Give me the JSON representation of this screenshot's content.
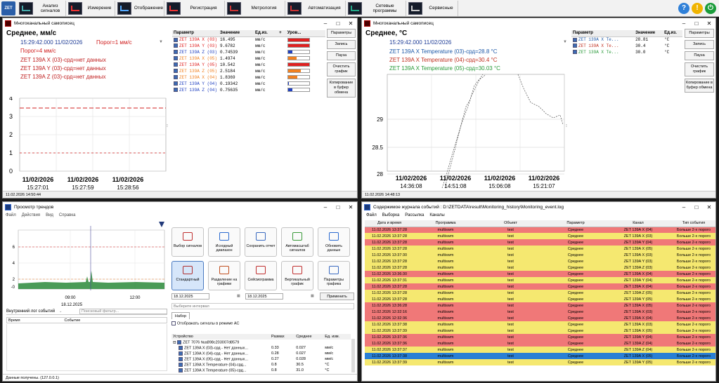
{
  "topbar": {
    "tabs": [
      {
        "label": "Анализ сигналов",
        "icon": "signal-analysis-icon"
      },
      {
        "label": "Измерение",
        "icon": "measurement-icon"
      },
      {
        "label": "Отображение",
        "icon": "display-icon"
      },
      {
        "label": "Регистрация",
        "icon": "registration-icon"
      },
      {
        "label": "Метрология",
        "icon": "metrology-icon"
      },
      {
        "label": "Автоматизация",
        "icon": "automation-icon"
      },
      {
        "label": "Сетевые программы",
        "icon": "network-icon"
      },
      {
        "label": "Сервисные",
        "icon": "service-icon"
      }
    ],
    "help": "?",
    "alert": "!",
    "power": "⏻",
    "colors": {
      "help": "#2f80d8",
      "alert": "#f0b400",
      "power": "#1a9c3a"
    }
  },
  "w1": {
    "title": "Многоканальный самописец",
    "heading": "Среднее, мм/с",
    "time": "15:29:42.000 11/02/2026",
    "threshold1": "Порог=1 мм/с",
    "threshold4": "Порог=4 мм/с",
    "lines": [
      "ZET 139A X (03)-срд=нет данных",
      "ZET 139A Y (03)-срд=нет данных",
      "ZET 139A Z (03)-срд=нет данных"
    ],
    "yticks": [
      "4",
      "3",
      "2",
      "1",
      "0"
    ],
    "xdates": [
      "11/02/2026",
      "11/02/2026",
      "11/02/2026"
    ],
    "xtimes": [
      "15:27:01",
      "15:27:59",
      "15:28:56"
    ],
    "table": {
      "cols": [
        "Параметр",
        "Значение",
        "Ед.из.",
        "+",
        "Уров..."
      ],
      "rows": [
        {
          "name": "ZET 139A X (03)",
          "value": "16.495",
          "unit": "мм/с",
          "level": 1.0,
          "color": "#e02020"
        },
        {
          "name": "ZET 139A Y (03)",
          "value": "9.6782",
          "unit": "мм/с",
          "level": 1.0,
          "color": "#e02020"
        },
        {
          "name": "ZET 139A Z (03)",
          "value": "0.74539",
          "unit": "мм/с",
          "level": 0.2,
          "color": "#2040c0"
        },
        {
          "name": "ZET 139A X (05)",
          "value": "1.4974",
          "unit": "мм/с",
          "level": 0.4,
          "color": "#f08020"
        },
        {
          "name": "ZET 139A Y (05)",
          "value": "10.542",
          "unit": "мм/с",
          "level": 1.0,
          "color": "#e02020"
        },
        {
          "name": "ZET 139A Z (05)",
          "value": "2.5184",
          "unit": "мм/с",
          "level": 0.6,
          "color": "#f08020"
        },
        {
          "name": "ZET 139A X (04)",
          "value": "1.8369",
          "unit": "мм/с",
          "level": 0.45,
          "color": "#f08020"
        },
        {
          "name": "ZET 139A Y (04)",
          "value": "0.19342",
          "unit": "мм/с",
          "level": 0.05,
          "color": "#2040c0"
        },
        {
          "name": "ZET 139A Z (04)",
          "value": "0.75635",
          "unit": "мм/с",
          "level": 0.2,
          "color": "#2040c0"
        }
      ]
    },
    "buttons": [
      "Параметры",
      "Запись",
      "Пауза",
      "Очистить график",
      "Копирование в буфер обмена"
    ],
    "status": "11.02.2026 14:50:44"
  },
  "w2": {
    "title": "Многоканальный самописец",
    "heading": "Среднее, °С",
    "time": "15:29:42.000 11/02/2026",
    "lines": [
      {
        "text": "ZET 139A X Temperature (03)-срд=28.8 °С",
        "color": "#1e5aa8"
      },
      {
        "text": "ZET 139A X Temperature (04)-срд=30.4 °С",
        "color": "#c03020"
      },
      {
        "text": "ZET 139A X Temperature (05)-срд=30.03 °С",
        "color": "#2a9a3a"
      }
    ],
    "yticks": [
      "29",
      "28.5",
      "28"
    ],
    "xdates": [
      "11/02/2026",
      "11/02/2026",
      "11/02/2026",
      "11/02/2026"
    ],
    "xtimes": [
      "14:36:08",
      "14:51:08",
      "15:06:08",
      "15:21:07"
    ],
    "table": {
      "cols": [
        "Параметр",
        "Значение",
        "Ед.из."
      ],
      "rows": [
        {
          "name": "ZET 139A X Te...",
          "value": "28.81",
          "unit": "°С",
          "color": "#1e5aa8"
        },
        {
          "name": "ZET 139A X Te...",
          "value": "30.4",
          "unit": "°С",
          "color": "#c03020"
        },
        {
          "name": "ZET 139A X Te...",
          "value": "30.0",
          "unit": "°С",
          "color": "#2a9a3a"
        }
      ]
    },
    "buttons": [
      "Параметры",
      "Запись",
      "Пауза",
      "Очистить график",
      "Копирование в буфер обмена"
    ],
    "status": "11.02.2026 14:48:13"
  },
  "w3": {
    "title": "Просмотр трендов",
    "menu": [
      "Файл",
      "Действия",
      "Вид",
      "Справка"
    ],
    "yticks": [
      "6",
      "4",
      "2",
      "-0"
    ],
    "xticks": [
      "09:00",
      "12:00"
    ],
    "xdate": "18.12.2025",
    "logtitle": "Внутренний лог событий",
    "filter": "Поисковый фильтр...",
    "logcols": [
      "Время",
      "Событие"
    ],
    "tools": [
      {
        "label": "Выбор сигналов",
        "icon": "select-signals-icon"
      },
      {
        "label": "Исходный диапазон",
        "icon": "reset-range-icon"
      },
      {
        "label": "Сохранить отчет",
        "icon": "save-report-icon"
      },
      {
        "label": "Автомасштаб сигналов",
        "icon": "autoscale-icon"
      },
      {
        "label": "Обновить данные",
        "icon": "refresh-icon"
      },
      {
        "label": "Стандартный",
        "icon": "standard-view-icon"
      },
      {
        "label": "Разделение на графики",
        "icon": "split-graphs-icon"
      },
      {
        "label": "Сейсмограмма",
        "icon": "seismogram-icon"
      },
      {
        "label": "Вертикальный график",
        "icon": "vertical-graph-icon"
      },
      {
        "label": "Параметры графика",
        "icon": "graph-params-icon"
      }
    ],
    "date_from": "18.12.2025",
    "date_to": "18.12.2025",
    "apply": "Применить",
    "interval": "Выберите интервал",
    "set_tab": "Набор",
    "ac_label": "Отображать сигналы в режиме AC",
    "devcols": [
      "Устройство",
      "Размах",
      "Среднее",
      "Ед. изм."
    ],
    "devices": [
      {
        "name": "ZET 7076 №a898c203007d8579",
        "span": "",
        "avg": "",
        "unit": "",
        "root": true
      },
      {
        "name": "ZET 139A X (03)-срд - Нет данных...",
        "span": "0.33",
        "avg": "0.027",
        "unit": "мм/с"
      },
      {
        "name": "ZET 139A X (04)-срд - Нет данных...",
        "span": "0.28",
        "avg": "0.027",
        "unit": "мм/с"
      },
      {
        "name": "ZET 139A X (05)-срд - Нет данных...",
        "span": "0.27",
        "avg": "0.028",
        "unit": "мм/с"
      },
      {
        "name": "ZET 139A X Temperature (04)-срд...",
        "span": "0.8",
        "avg": "30.5",
        "unit": "°С"
      },
      {
        "name": "ZET 139A X Temperature (05)-срд...",
        "span": "0.8",
        "avg": "31.0",
        "unit": "°С"
      }
    ],
    "status": "Данные получены. (127.0.0.1)"
  },
  "w4": {
    "title": "Содержимое журнала событий : D:\\ZETDATA\\result\\Monitoring_history\\Monitoring_event.log",
    "menu": [
      "Файл",
      "Выборка",
      "Рассылка",
      "Каналы"
    ],
    "cols": [
      "Дата и время",
      "Программа",
      "Объект",
      "Параметр",
      "Канал",
      "Тип события"
    ],
    "rows": [
      [
        "11.02.2026 13:37:28",
        "multiswm",
        "test",
        "Среднее",
        "ZET 139A X (04)",
        "Больше 2-х порого"
      ],
      [
        "11.02.2026 13:37:28",
        "multiswm",
        "test",
        "Среднее",
        "ZET 139A X (03)",
        "Больше 2-х порого"
      ],
      [
        "11.02.2026 13:37:28",
        "multiswm",
        "test",
        "Среднее",
        "ZET 139A Y (04)",
        "Больше 2-х порого"
      ],
      [
        "11.02.2026 13:37:28",
        "multiswm",
        "test",
        "Среднее",
        "ZET 139A X (05)",
        "Больше 2-х порого"
      ],
      [
        "11.02.2026 13:37:30",
        "multiswm",
        "test",
        "Среднее",
        "ZET 139A X (03)",
        "Больше 2-х порого"
      ],
      [
        "11.02.2026 13:37:28",
        "multiswm",
        "test",
        "Среднее",
        "ZET 139A Y (03)",
        "Больше 2-х порого"
      ],
      [
        "11.02.2026 13:37:28",
        "multiswm",
        "test",
        "Среднее",
        "ZET 139A Z (03)",
        "Больше 2-х порого"
      ],
      [
        "11.02.2026 13:36:30",
        "multiswm",
        "test",
        "Среднее",
        "ZET 139A X (04)",
        "Больше 2-х порого"
      ],
      [
        "11.02.2026 13:37:31",
        "multiswm",
        "test",
        "Среднее",
        "ZET 139A Y (04)",
        "Больше 2-х порого"
      ],
      [
        "11.02.2026 13:37:28",
        "multiswm",
        "test",
        "Среднее",
        "ZET 139A X (04)",
        "Больше 2-х порого"
      ],
      [
        "11.02.2026 13:37:28",
        "multiswm",
        "test",
        "Среднее",
        "ZET 139A Z (05)",
        "Больше 2-х порого"
      ],
      [
        "11.02.2026 13:37:28",
        "multiswm",
        "test",
        "Среднее",
        "ZET 139A Y (05)",
        "Больше 2-х порого"
      ],
      [
        "11.02.2026 13:36:28",
        "multiswm",
        "test",
        "Среднее",
        "ZET 139A X (05)",
        "Больше 2-х порого"
      ],
      [
        "11.02.2026 12:32:16",
        "multiswm",
        "test",
        "Среднее",
        "ZET 139A X (03)",
        "Больше 2-х порого"
      ],
      [
        "11.02.2026 12:32:36",
        "multiswm",
        "test",
        "Среднее",
        "ZET 139A X (04)",
        "Больше 2-х порого"
      ],
      [
        "11.02.2026 13:37:38",
        "multiswm",
        "test",
        "Среднее",
        "ZET 139A X (03)",
        "Больше 2-х порого"
      ],
      [
        "11.02.2026 13:37:39",
        "multiswm",
        "test",
        "Среднее",
        "ZET 139A X (05)",
        "Больше 2-х порого"
      ],
      [
        "11.02.2026 13:37:36",
        "multiswm",
        "test",
        "Среднее",
        "ZET 139A Y (04)",
        "Больше 2-х порого"
      ],
      [
        "11.02.2026 13:37:36",
        "multiswm",
        "test",
        "Среднее",
        "ZET 139A Z (04)",
        "Больше 2-х порого"
      ],
      [
        "11.02.2026 13:37:37",
        "multiswm",
        "test",
        "Среднее",
        "ZET 139A Z (04)",
        "Больше 2-х порого"
      ],
      [
        "11.02.2026 13:37:38",
        "multiswm",
        "test",
        "Среднее",
        "ZET 139A X (05)",
        "Больше 2-х порого"
      ],
      [
        "11.02.2026 13:37:39",
        "multiswm",
        "test",
        "Среднее",
        "ZET 139A Y (05)",
        "Больше 2-х порого"
      ]
    ],
    "rowcolors": [
      "#f07878",
      "#f5e870",
      "#f07878",
      "#f5e870",
      "#f5e870",
      "#f5e870",
      "#f5e870",
      "#f07878",
      "#f5e870",
      "#f07878",
      "#f5e870",
      "#f5e870",
      "#f07878",
      "#f07878",
      "#f07878",
      "#f5e870",
      "#f5e870",
      "#f07878",
      "#f07878",
      "#f5e870",
      "#2a7fd4",
      "#f5e870"
    ]
  }
}
